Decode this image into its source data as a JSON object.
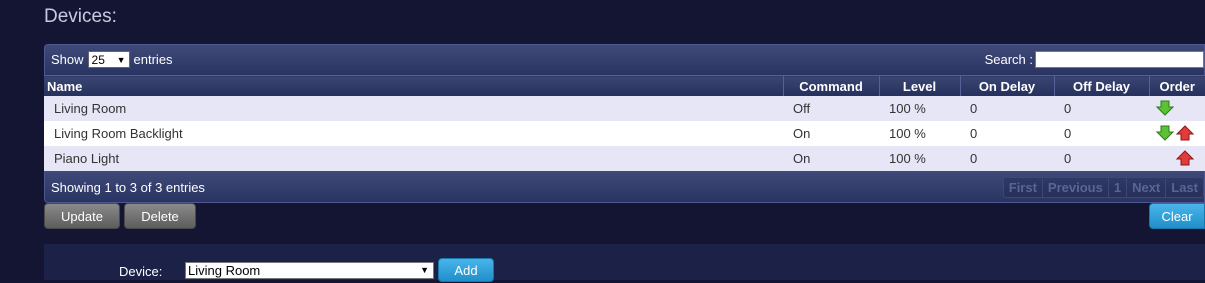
{
  "page": {
    "title": "Devices:"
  },
  "table": {
    "show_label": "Show",
    "entries_label": "entries",
    "length_value": "25",
    "search_label": "Search :",
    "search_value": "",
    "columns": [
      "Name",
      "Command",
      "Level",
      "On Delay",
      "Off Delay",
      "Order"
    ],
    "rows": [
      {
        "name": "Living Room",
        "command": "Off",
        "level": "100 %",
        "on_delay": "0",
        "off_delay": "0",
        "order_down": true,
        "order_up": false
      },
      {
        "name": "Living Room Backlight",
        "command": "On",
        "level": "100 %",
        "on_delay": "0",
        "off_delay": "0",
        "order_down": true,
        "order_up": true
      },
      {
        "name": "Piano Light",
        "command": "On",
        "level": "100 %",
        "on_delay": "0",
        "off_delay": "0",
        "order_down": false,
        "order_up": true
      }
    ],
    "info": "Showing 1 to 3 of 3 entries",
    "paging": {
      "first": "First",
      "previous": "Previous",
      "page": "1",
      "next": "Next",
      "last": "Last"
    }
  },
  "buttons": {
    "update": "Update",
    "delete": "Delete",
    "clear": "Clear"
  },
  "add_form": {
    "device_label": "Device:",
    "device_value": "Living Room",
    "add": "Add"
  },
  "icons": {
    "order_down": "green-down-arrow-icon",
    "order_up": "red-up-arrow-icon"
  },
  "colors": {
    "background": "#131533",
    "header": "#2a3462",
    "odd_row": "#e6e6f6",
    "arrow_down": "#5bc236",
    "arrow_up": "#e23b3b",
    "accent": "#1f8fcb"
  }
}
